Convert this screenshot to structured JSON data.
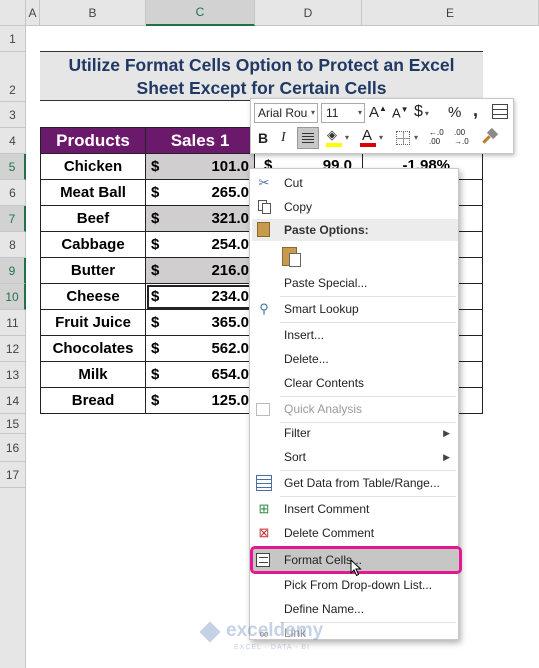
{
  "sheet": {
    "columns": [
      "A",
      "B",
      "C",
      "D",
      "E"
    ],
    "rows": [
      "1",
      "2",
      "3",
      "4",
      "5",
      "6",
      "7",
      "8",
      "9",
      "10",
      "11",
      "12",
      "13",
      "14",
      "15",
      "16",
      "17"
    ],
    "title_line1": "Utilize Format Cells Option to Protect an Excel",
    "title_line2": "Sheet Except for Certain Cells",
    "headers": {
      "products": "Products",
      "sales": "Sales 1"
    },
    "currency": "$",
    "table": [
      {
        "product": "Chicken",
        "sales": "101.0"
      },
      {
        "product": "Meat Ball",
        "sales": "265.0"
      },
      {
        "product": "Beef",
        "sales": "321.0"
      },
      {
        "product": "Cabbage",
        "sales": "254.0"
      },
      {
        "product": "Butter",
        "sales": "216.0"
      },
      {
        "product": "Cheese",
        "sales": "234.0"
      },
      {
        "product": "Fruit Juice",
        "sales": "365.0"
      },
      {
        "product": "Chocolates",
        "sales": "562.0"
      },
      {
        "product": "Milk",
        "sales": "654.0"
      },
      {
        "product": "Bread",
        "sales": "125.0"
      }
    ],
    "partial_d5": "99.0",
    "partial_e5": "-1.98%"
  },
  "mini_toolbar": {
    "font_name": "Arial Rou",
    "font_size": "11",
    "currency_symbol": "$",
    "percent_symbol": "%",
    "comma_symbol": ",",
    "bold": "B",
    "italic": "I",
    "font_color_letter": "A",
    "increase_font": "A",
    "decrease_font": "A",
    "inc_decimal": "←.0\n.00",
    "dec_decimal": ".00\n→.0"
  },
  "context_menu": {
    "cut": "Cut",
    "copy": "Copy",
    "paste_options": "Paste Options:",
    "paste_special": "Paste Special...",
    "smart_lookup": "Smart Lookup",
    "insert": "Insert...",
    "delete": "Delete...",
    "clear_contents": "Clear Contents",
    "quick_analysis": "Quick Analysis",
    "filter": "Filter",
    "sort": "Sort",
    "get_data": "Get Data from Table/Range...",
    "insert_comment": "Insert Comment",
    "delete_comment": "Delete Comment",
    "format_cells": "Format Cells...",
    "pick_from_list": "Pick From Drop-down List...",
    "define_name": "Define Name...",
    "link": "Link"
  },
  "watermark": {
    "brand": "exceldemy",
    "tagline": "EXCEL · DATA · BI"
  },
  "colors": {
    "header_purple": "#6b1a6b",
    "title_blue": "#1f3864",
    "highlight_pink": "#e3198f",
    "excel_green": "#217346"
  }
}
